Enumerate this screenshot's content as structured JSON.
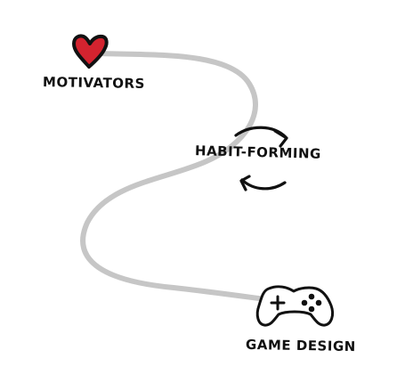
{
  "diagram": {
    "nodes": [
      {
        "id": "motivators",
        "label": "MOTIVATORS",
        "icon": "heart-icon"
      },
      {
        "id": "habit_forming",
        "label": "HABIT-FORMING",
        "icon": "cycle-arrows-icon"
      },
      {
        "id": "game_design",
        "label": "GAME DESIGN",
        "icon": "game-controller-icon"
      }
    ],
    "connector": {
      "style": "curved-path",
      "color": "#c6c6c6"
    },
    "colors": {
      "ink": "#111111",
      "heart": "#d3232f",
      "path": "#c6c6c6",
      "background": "#ffffff"
    }
  }
}
